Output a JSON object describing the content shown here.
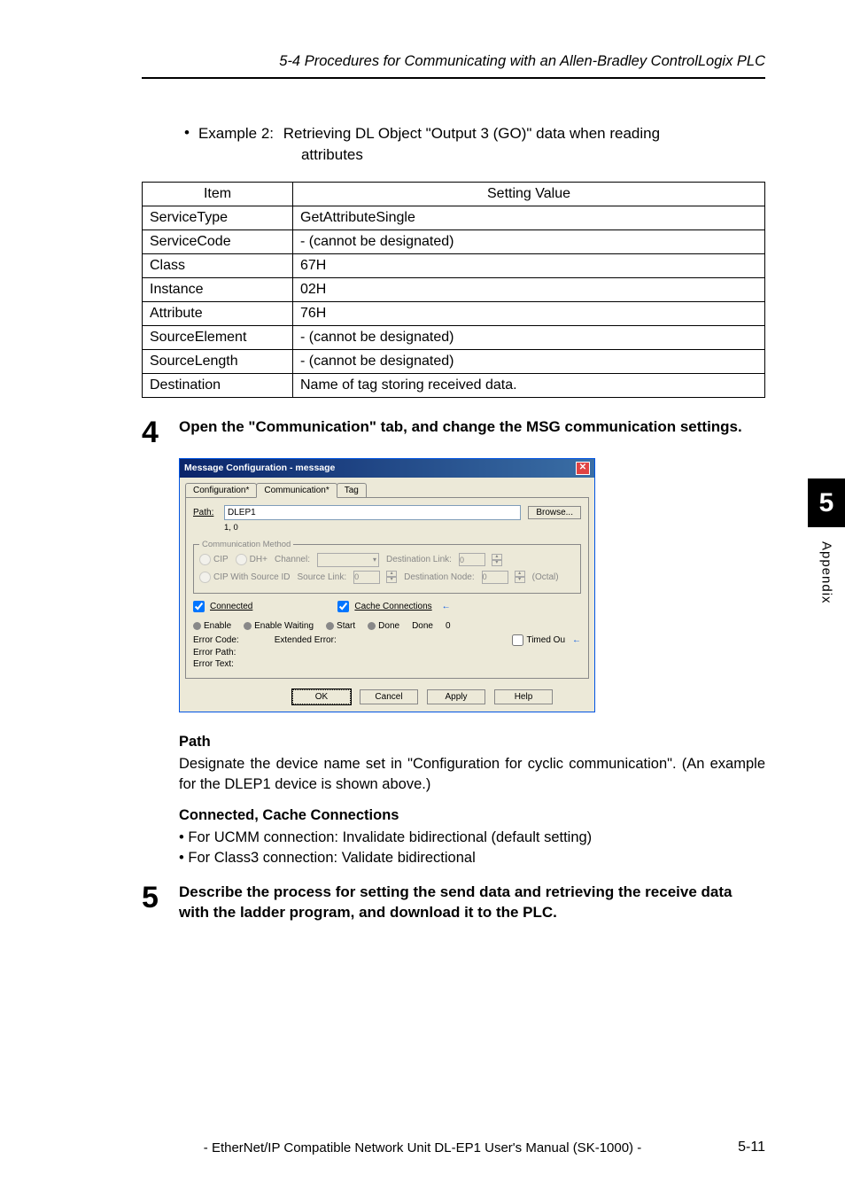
{
  "header": "5-4 Procedures for Communicating with an Allen-Bradley ControlLogix PLC",
  "example": {
    "bullet": "•",
    "label": "Example 2:",
    "text_line1": "Retrieving DL Object \"Output 3 (GO)\" data when reading",
    "text_line2": "attributes"
  },
  "table": {
    "headers": {
      "item": "Item",
      "value": "Setting Value"
    },
    "rows": [
      {
        "item": "ServiceType",
        "value": "GetAttributeSingle"
      },
      {
        "item": "ServiceCode",
        "value": "- (cannot be designated)"
      },
      {
        "item": "Class",
        "value": "67H"
      },
      {
        "item": "Instance",
        "value": "02H"
      },
      {
        "item": "Attribute",
        "value": "76H"
      },
      {
        "item": "SourceElement",
        "value": "- (cannot be designated)"
      },
      {
        "item": "SourceLength",
        "value": "- (cannot be designated)"
      },
      {
        "item": "Destination",
        "value": "Name of tag storing received data."
      }
    ]
  },
  "step4": {
    "num": "4",
    "text": "Open the \"Communication\" tab, and change the MSG communication settings."
  },
  "dialog": {
    "title": "Message Configuration - message",
    "tabs": {
      "t1": "Configuration*",
      "t2": "Communication*",
      "t3": "Tag"
    },
    "path_label": "Path:",
    "path_value": "DLEP1",
    "sub_path": "1, 0",
    "browse": "Browse...",
    "comm_method_legend": "Communication Method",
    "radio_cip": "CIP",
    "radio_dh": "DH+",
    "channel_lbl": "Channel:",
    "dest_link_lbl": "Destination Link:",
    "dest_link_val": "0",
    "radio_cip_with": "CIP With Source ID",
    "source_link_lbl": "Source Link:",
    "source_link_val": "0",
    "dest_node_lbl": "Destination Node:",
    "dest_node_val": "0",
    "octal": "(Octal)",
    "connected_lbl": "Connected",
    "cache_lbl": "Cache Connections",
    "arrow": "←",
    "status": {
      "enable": "Enable",
      "enable_waiting": "Enable Waiting",
      "start": "Start",
      "done": "Done",
      "done_lbl": "Done",
      "done_val": "0"
    },
    "error_code_lbl": "Error Code:",
    "extended_error_lbl": "Extended Error:",
    "timed_out_lbl": "Timed Ou",
    "error_path_lbl": "Error Path:",
    "error_text_lbl": "Error Text:",
    "buttons": {
      "ok": "OK",
      "cancel": "Cancel",
      "apply": "Apply",
      "help": "Help"
    }
  },
  "path_section": {
    "heading": "Path",
    "text": "Designate the device name set in \"Configuration for cyclic communication\". (An example for the DLEP1 device is shown above.)"
  },
  "conn_section": {
    "heading": "Connected, Cache Connections",
    "b1": "For UCMM connection: Invalidate bidirectional (default setting)",
    "b2": "For Class3 connection: Validate bidirectional"
  },
  "step5": {
    "num": "5",
    "text": "Describe the process for setting the send data and retrieving the receive data with the ladder program, and download it to the PLC."
  },
  "side": {
    "num": "5",
    "text": "Appendix"
  },
  "footer": {
    "text": "- EtherNet/IP Compatible Network Unit DL-EP1 User's Manual (SK-1000) -",
    "page": "5-11"
  }
}
